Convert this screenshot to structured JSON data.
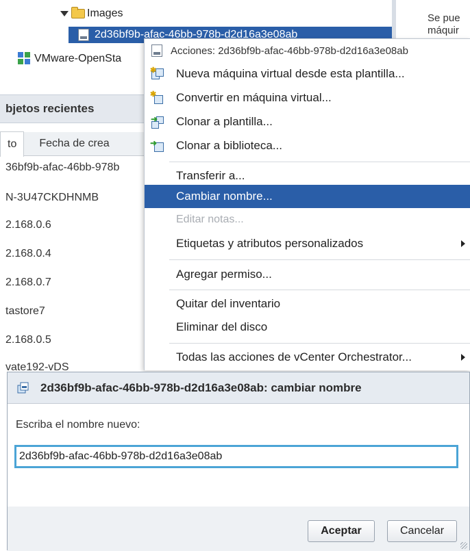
{
  "tree": {
    "images_label": "Images",
    "selected_label": "2d36bf9b-afac-46bb-978b-d2d16a3e08ab",
    "vapp_label": "VMware-OpenSta"
  },
  "right_panel": {
    "line1": "Se pue",
    "line2": "máquir"
  },
  "left_panel": {
    "header": "bjetos recientes",
    "tab_active": "to",
    "tab_inactive": "Fecha de crea",
    "items": [
      "36bf9b-afac-46bb-978b",
      "N-3U47CKDHNMB",
      "2.168.0.6",
      "2.168.0.4",
      "2.168.0.7",
      "tastore7",
      "2.168.0.5",
      "vate192-vDS"
    ]
  },
  "context_menu": {
    "header": "Acciones: 2d36bf9b-afac-46bb-978b-d2d16a3e08ab",
    "new_vm": "Nueva máquina virtual desde esta plantilla...",
    "convert_vm": "Convertir en máquina virtual...",
    "clone_template": "Clonar a plantilla...",
    "clone_library": "Clonar a biblioteca...",
    "transfer": "Transferir a...",
    "rename": "Cambiar nombre...",
    "edit_notes": "Editar notas...",
    "tags": "Etiquetas y atributos personalizados",
    "add_permission": "Agregar permiso...",
    "remove_inventory": "Quitar del inventario",
    "delete_disk": "Eliminar del disco",
    "orchestrator": "Todas las acciones de vCenter Orchestrator..."
  },
  "dialog": {
    "title": "2d36bf9b-afac-46bb-978b-d2d16a3e08ab: cambiar nombre",
    "prompt": "Escriba el nombre nuevo:",
    "input_value": "2d36bf9b-afac-46bb-978b-d2d16a3e08ab",
    "ok_label": "Aceptar",
    "cancel_label": "Cancelar"
  },
  "colors": {
    "highlight": "#2a5ea8",
    "input_focus": "#4ba4d6"
  }
}
